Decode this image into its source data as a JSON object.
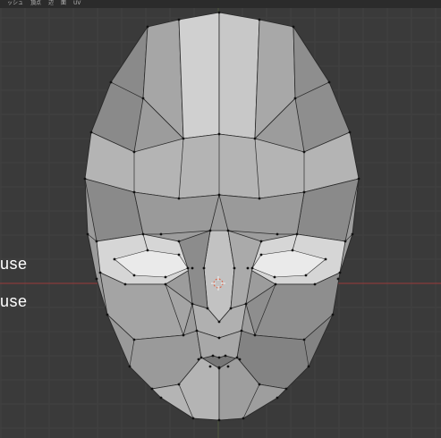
{
  "menu": {
    "items": [
      "ッシュ",
      "頂点",
      "辺",
      "面",
      "UV"
    ]
  },
  "captions": [
    "use",
    "use"
  ],
  "colors": {
    "background": "#3a3a3a",
    "grid_minor": "#414141",
    "grid_major": "#2e2e2e",
    "axis_red": "#9a3b3b",
    "axis_green": "#6b8e3a",
    "mesh_light": "#c8c8c8",
    "mesh_mid": "#a2a2a2",
    "mesh_dark": "#7c7c7c",
    "edge": "#2a2a2a",
    "vertex": "#111111"
  },
  "icons": [
    "3d-cursor-icon"
  ]
}
